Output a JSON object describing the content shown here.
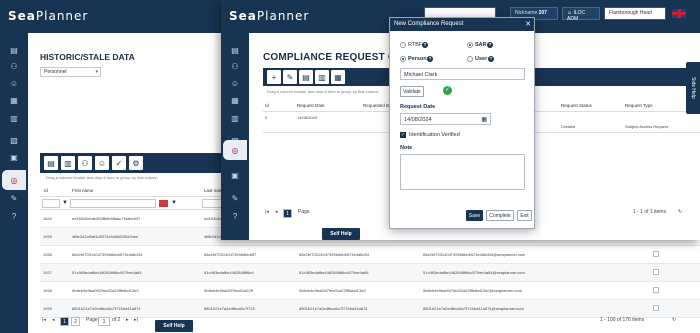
{
  "app": {
    "logo_sea": "Sea",
    "logo_planner": "Planner"
  },
  "back": {
    "title": "HISTORIC/STALE DATA",
    "filter_value": "Personnel",
    "drag_hint": "Drag a column header and drop it here to group by that column",
    "columns": [
      "Id",
      "First name",
      "Last name"
    ],
    "rows": [
      {
        "id": "1824",
        "first": "ed163c5cbde4f4f8bfe68aac7f4dbe637",
        "last": "ed163c5cbde4f4f8bfe68aac",
        "mid": "",
        "email": ""
      },
      {
        "id": "1925",
        "first": "4f8e2d1cf9af1d9374c94d582f0d34ee",
        "last": "4f8e2d1cf9af1d9374c94d58",
        "mid": "",
        "email": ""
      },
      {
        "id": "1926",
        "first": "66e2bf70314047399b6bb6573e4d6d34",
        "last": "66e2bf70314047399b6bb657",
        "mid": "66e2bf70314047399b6bb6573e4d6d34",
        "email": "66e2bf70314047399b6bb6573e4d6d34@seaplanner.com"
      },
      {
        "id": "1927",
        "first": "51c983edaf6e4462846ff6cd579ee4a84",
        "last": "51c983edaf6e4462846ff6cd",
        "mid": "51c983edaf6e4462846ff6cd579ee4a84",
        "email": "51c983edaf6e4462846ff6cd579ee4a84@seaplanner.com"
      },
      {
        "id": "1928",
        "first": "0b6eb4e9ba0f47fea31a22ff6dbd13e0",
        "last": "0b6eb4e9ba0f47fea31a22ff",
        "mid": "0b6eb4e9ba0f47fea31a22ff6dbd13e0",
        "email": "0b6eb4e9ba0f47fea31a22ff6dbd13e0@seaplanner.com"
      },
      {
        "id": "1929",
        "first": "8801b21e7a2e4fbcd6c7f715bd41a874",
        "last": "8801b21e7a2e4fbcd6c7f715",
        "mid": "8801b21e7a2e4fbcd6c7f715bd41a874",
        "email": "8801b21e7a2e4fbcd6c7f715bd41a874@seaplanner.com"
      }
    ],
    "pager_page": "1",
    "pager_label": "Page",
    "pager_of": "of 2",
    "pager_info": "1 - 100 of 176 items",
    "self_help": "Self Help"
  },
  "mid": {
    "title": "COMPLIANCE REQUEST OVER",
    "drag_hint": "Drag a column header and drop it here to group by that column",
    "columns": [
      "Id",
      "Request Date",
      "Requested B",
      "Request Status",
      "Request Type"
    ],
    "filter_id": "0",
    "filter_date": "14/08/2024",
    "filter_status": "Created",
    "filter_type": "Subject Access Request",
    "pager_page": "1",
    "pager_label": "Page",
    "pager_info": "1 - 1 of 1 items",
    "self_help": "Self Help",
    "side_tab": "Side Help",
    "user_id": "Nickname",
    "user_count": "207",
    "user_role": "ILOC ADM",
    "location": "Flamborough Head"
  },
  "modal": {
    "title": "New Compliance Request",
    "opt_rtbf": "RTBF",
    "opt_sar": "SAR",
    "opt_person": "Person",
    "opt_user": "User",
    "person_value": "Michael Clark",
    "validate_label": "Validate",
    "request_date_label": "Request Date",
    "request_date_value": "14/08/2024",
    "identification_label": "Identification Verified",
    "note_label": "Note",
    "save_label": "Save",
    "complete_label": "Complete",
    "exit_label": "Exit"
  },
  "colors": {
    "navy": "#173452",
    "accent_red": "#b30f24",
    "ok_green": "#2ea34a"
  }
}
